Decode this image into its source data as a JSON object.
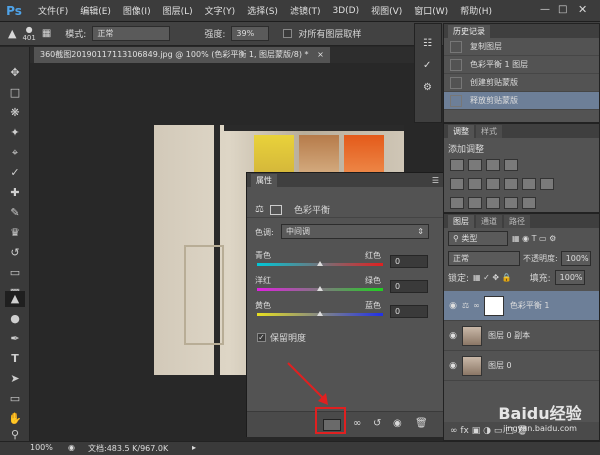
{
  "app": {
    "logo": "Ps"
  },
  "menu": [
    "文件(F)",
    "编辑(E)",
    "图像(I)",
    "图层(L)",
    "文字(Y)",
    "选择(S)",
    "滤镜(T)",
    "3D(D)",
    "视图(V)",
    "窗口(W)",
    "帮助(H)"
  ],
  "options": {
    "brush_size": "401",
    "mode_label": "模式:",
    "mode_value": "正常",
    "strength_label": "强度:",
    "strength_value": "39%",
    "sample_all_label": "对所有图层取样"
  },
  "document": {
    "tab_title": "360截图20190117113106849.jpg @ 100% (色彩平衡 1, 图层蒙版/8) *"
  },
  "status": {
    "zoom": "100%",
    "doc_info": "文档:483.5 K/967.0K"
  },
  "history": {
    "title": "历史记录",
    "items": [
      {
        "label": "复制图层",
        "selected": false
      },
      {
        "label": "色彩平衡 1 图层",
        "selected": false
      },
      {
        "label": "创建剪贴蒙版",
        "selected": false
      },
      {
        "label": "释放剪贴蒙版",
        "selected": true
      }
    ]
  },
  "adjustments": {
    "tabs": [
      "调整",
      "样式"
    ],
    "add_label": "添加调整"
  },
  "layers": {
    "tabs": [
      "图层",
      "通道",
      "路径"
    ],
    "kind_label": "类型",
    "blend": "正常",
    "opacity_label": "不透明度:",
    "opacity_value": "100%",
    "lock_label": "锁定:",
    "fill_label": "填充:",
    "fill_value": "100%",
    "items": [
      {
        "name": "色彩平衡 1",
        "selected": true
      },
      {
        "name": "图层 0 副本",
        "selected": false
      },
      {
        "name": "图层 0",
        "selected": false
      }
    ]
  },
  "properties": {
    "title": "属性",
    "subtitle": "色彩平衡",
    "tone_label": "色调:",
    "tone_value": "中间调",
    "sliders": [
      {
        "left": "青色",
        "right": "红色",
        "value": "0",
        "level": 0.5
      },
      {
        "left": "洋红",
        "right": "绿色",
        "value": "0",
        "level": 0.5
      },
      {
        "left": "黄色",
        "right": "蓝色",
        "value": "0",
        "level": 0.5
      }
    ],
    "preserve_label": "保留明度",
    "preserve_checked": true
  },
  "watermark": {
    "text": "Baidu经验",
    "url": "jingyan.baidu.com"
  },
  "colors": {
    "accent": "#6d7f98",
    "highlight_box": "#e02020",
    "arrow": "#e02020"
  }
}
